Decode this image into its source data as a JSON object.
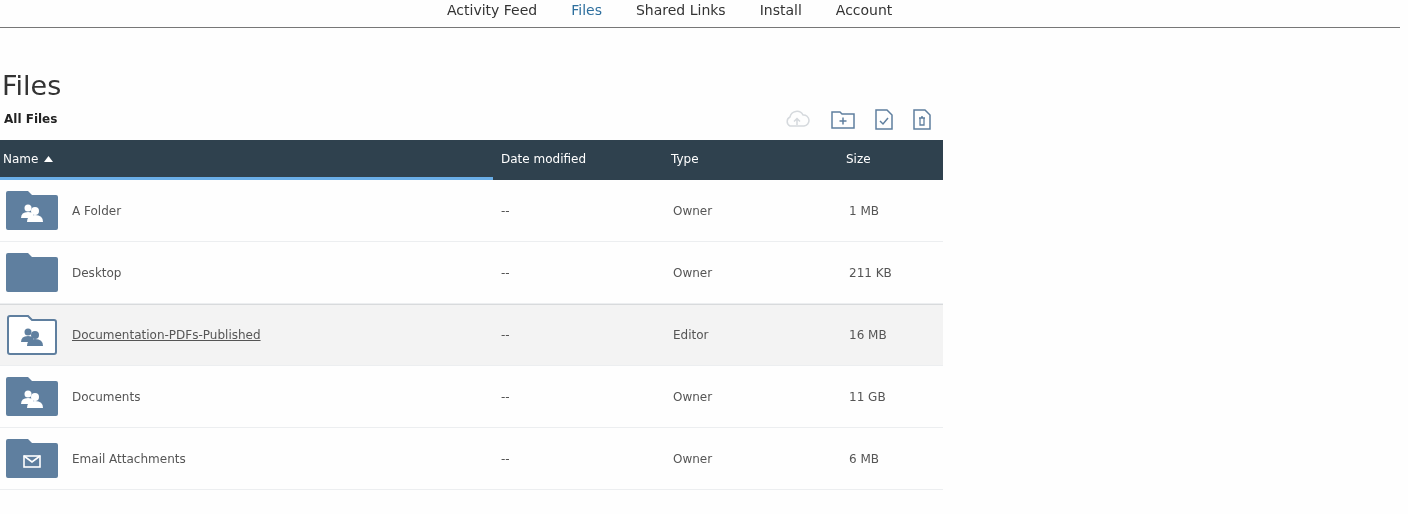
{
  "nav": [
    {
      "label": "Activity Feed",
      "selected": false
    },
    {
      "label": "Files",
      "selected": true
    },
    {
      "label": "Shared Links",
      "selected": false
    },
    {
      "label": "Install",
      "selected": false
    },
    {
      "label": "Account",
      "selected": false
    }
  ],
  "page_title": "Files",
  "breadcrumb": "All Files",
  "toolbar": [
    {
      "kind": "upload",
      "disabled": true
    },
    {
      "kind": "new-folder",
      "disabled": false
    },
    {
      "kind": "select",
      "disabled": false
    },
    {
      "kind": "delete",
      "disabled": false
    }
  ],
  "table": {
    "columns": [
      {
        "label": "Name",
        "sorted": true
      },
      {
        "label": "Date modified",
        "sorted": false
      },
      {
        "label": "Type",
        "sorted": false
      },
      {
        "label": "Size",
        "sorted": false
      }
    ],
    "rows": [
      {
        "kind": "shared",
        "name": "A Folder",
        "date": "--",
        "type": "Owner",
        "size": "1 MB",
        "hovered": false
      },
      {
        "kind": "plain",
        "name": "Desktop",
        "date": "--",
        "type": "Owner",
        "size": "211 KB",
        "hovered": false
      },
      {
        "kind": "shared",
        "name": "Documentation-PDFs-Published",
        "date": "--",
        "type": "Editor",
        "size": "16 MB",
        "hovered": true
      },
      {
        "kind": "shared",
        "name": "Documents",
        "date": "--",
        "type": "Owner",
        "size": "11 GB",
        "hovered": false
      },
      {
        "kind": "email",
        "name": "Email Attachments",
        "date": "--",
        "type": "Owner",
        "size": "6 MB",
        "hovered": false
      }
    ]
  }
}
